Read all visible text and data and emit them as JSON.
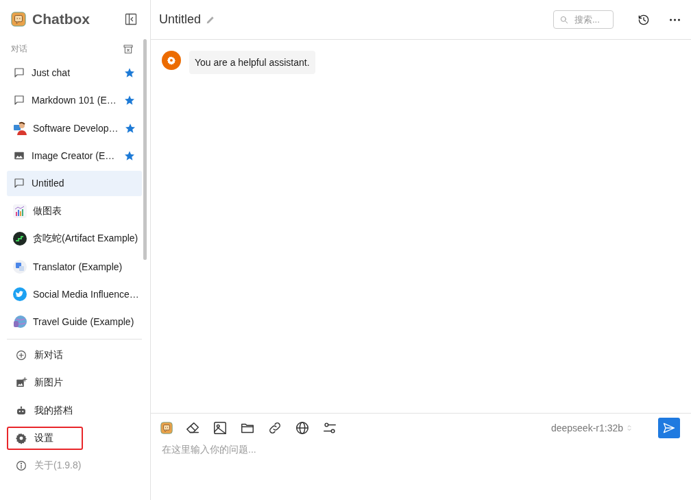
{
  "sidebar": {
    "app_name": "Chatbox",
    "section_label": "对话",
    "sessions": [
      {
        "label": "Just chat",
        "kind": "chat",
        "starred": true,
        "selected": false
      },
      {
        "label": "Markdown 101 (E…",
        "kind": "chat",
        "starred": true,
        "selected": false
      },
      {
        "label": "Software Develop…",
        "kind": "developer",
        "starred": true,
        "selected": false
      },
      {
        "label": "Image Creator (E…",
        "kind": "image",
        "starred": true,
        "selected": false
      },
      {
        "label": "Untitled",
        "kind": "chat",
        "starred": false,
        "selected": true
      },
      {
        "label": "做图表",
        "kind": "chart",
        "starred": false,
        "selected": false
      },
      {
        "label": "贪吃蛇(Artifact Example)",
        "kind": "snake",
        "starred": false,
        "selected": false
      },
      {
        "label": "Translator (Example)",
        "kind": "translate",
        "starred": false,
        "selected": false
      },
      {
        "label": "Social Media Influence…",
        "kind": "bird",
        "starred": false,
        "selected": false
      },
      {
        "label": "Travel Guide (Example)",
        "kind": "globe",
        "starred": false,
        "selected": false
      }
    ],
    "actions": [
      {
        "label": "新对话",
        "kind": "plus",
        "highlighted": false,
        "muted": false
      },
      {
        "label": "新图片",
        "kind": "image",
        "highlighted": false,
        "muted": false
      },
      {
        "label": "我的搭档",
        "kind": "robot",
        "highlighted": false,
        "muted": false
      },
      {
        "label": "设置",
        "kind": "gear",
        "highlighted": true,
        "muted": false
      },
      {
        "label": "关于(1.9.8)",
        "kind": "info",
        "highlighted": false,
        "muted": true
      }
    ]
  },
  "header": {
    "title": "Untitled",
    "search": {
      "placeholder": "搜索..."
    }
  },
  "messages": [
    {
      "text": "You are a helpful assistant."
    }
  ],
  "composer": {
    "model": "deepseek-r1:32b",
    "placeholder": "在这里输入你的问题..."
  }
}
